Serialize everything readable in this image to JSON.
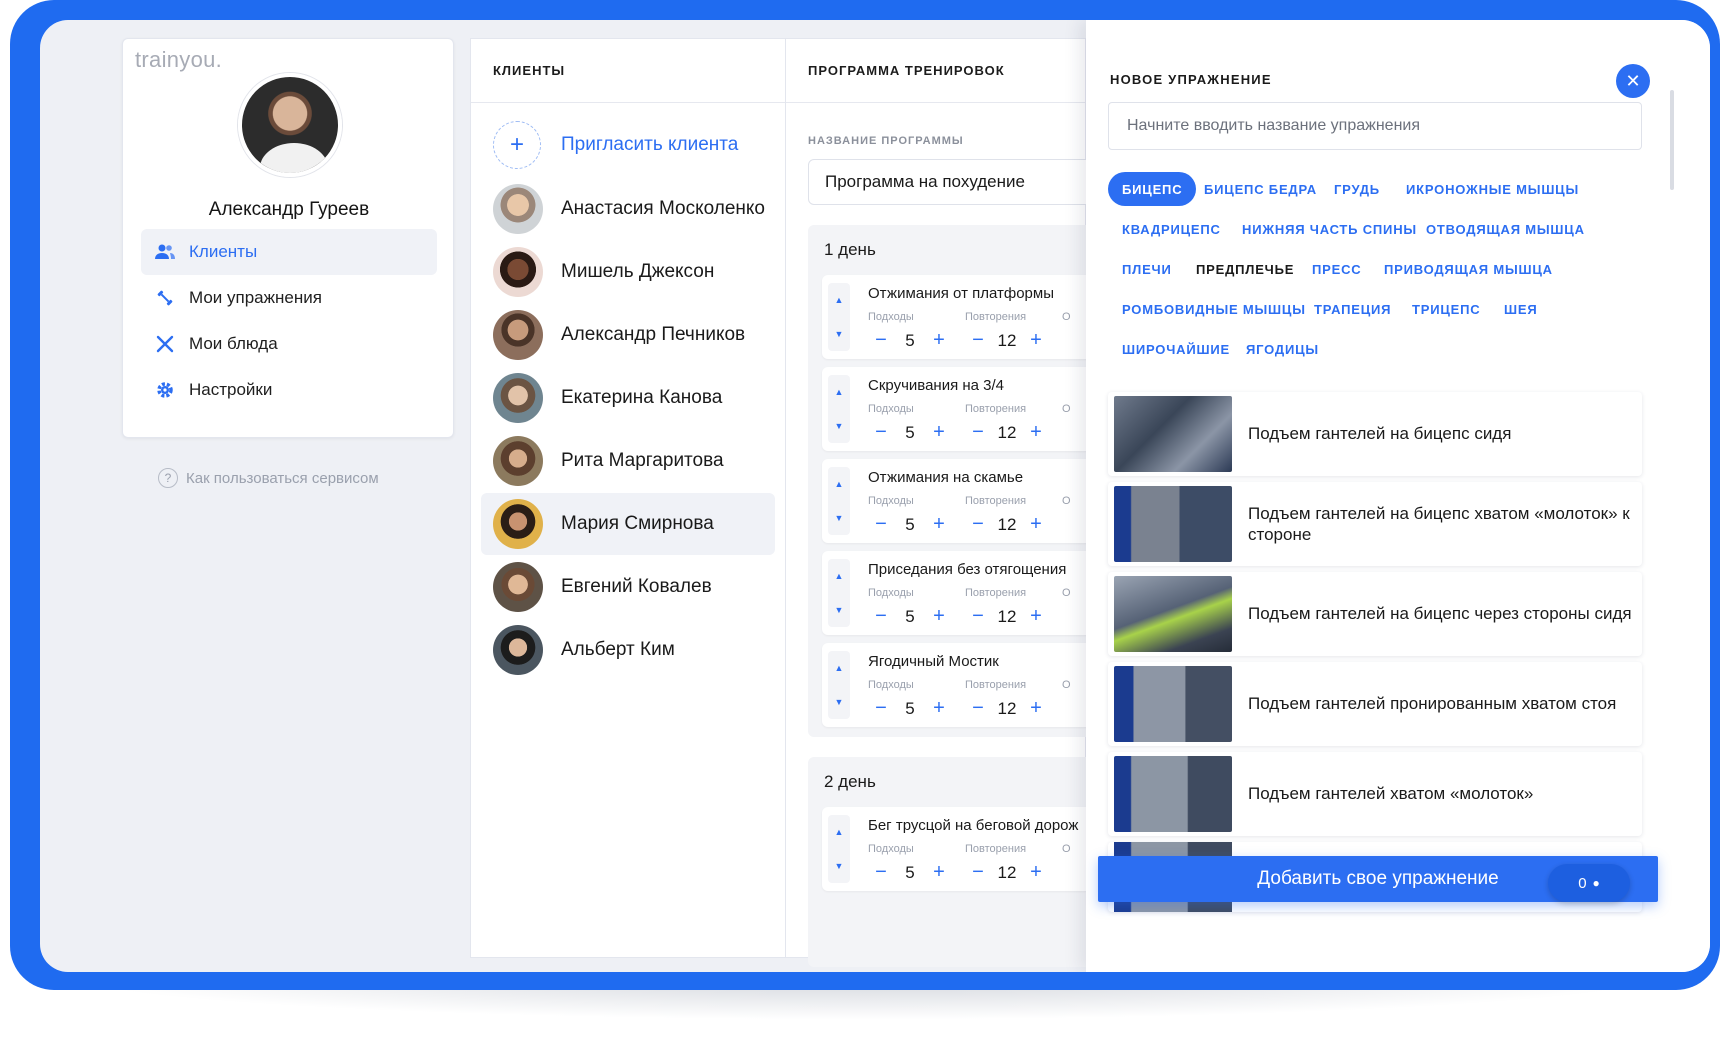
{
  "app": {
    "logo": "trainyou."
  },
  "profile": {
    "name": "Александр Гуреев"
  },
  "nav": {
    "items": [
      {
        "label": "Клиенты",
        "icon": "users-icon",
        "active": true
      },
      {
        "label": "Мои упражнения",
        "icon": "dumbbell-icon",
        "active": false
      },
      {
        "label": "Мои блюда",
        "icon": "cutlery-icon",
        "active": false
      },
      {
        "label": "Настройки",
        "icon": "gear-icon",
        "active": false
      }
    ],
    "help": "Как пользоваться сервисом"
  },
  "clients": {
    "header": "КЛИЕНТЫ",
    "invite": "Пригласить клиента",
    "list": [
      {
        "name": "Анастасия Москоленко"
      },
      {
        "name": "Мишель Джексон"
      },
      {
        "name": "Александр Печников"
      },
      {
        "name": "Екатерина Канова"
      },
      {
        "name": "Рита Маргаритова"
      },
      {
        "name": "Мария Смирнова",
        "selected": true
      },
      {
        "name": "Евгений Ковалев"
      },
      {
        "name": "Альберт Ким"
      }
    ]
  },
  "program": {
    "header": "ПРОГРАММА ТРЕНИРОВОК",
    "name_label": "НАЗВАНИЕ ПРОГРАММЫ",
    "name_value": "Программа на похудение",
    "sets_label": "Подходы",
    "reps_label": "Повторения",
    "third_label_partial": "О",
    "days": [
      {
        "title": "1 день",
        "exercises": [
          {
            "name": "Отжимания от платформы",
            "sets": "5",
            "reps": "12"
          },
          {
            "name": "Скручивания на 3/4",
            "sets": "5",
            "reps": "12"
          },
          {
            "name": "Отжимания на скамье",
            "sets": "5",
            "reps": "12"
          },
          {
            "name": "Приседания без отягощения",
            "sets": "5",
            "reps": "12"
          },
          {
            "name": "Ягодичный Мостик",
            "sets": "5",
            "reps": "12"
          }
        ]
      },
      {
        "title": "2 день",
        "exercises": [
          {
            "name": "Бег трусцой на беговой дорож",
            "sets": "5",
            "reps": "12"
          }
        ]
      }
    ]
  },
  "new_exercise": {
    "title": "НОВОЕ УПРАЖНЕНИЕ",
    "search_placeholder": "Начните вводить название упражнения",
    "tags": [
      "БИЦЕПС",
      "БИЦЕПС БЕДРА",
      "ГРУДЬ",
      "ИКРОНОЖНЫЕ МЫШЦЫ",
      "КВАДРИЦЕПС",
      "НИЖНЯЯ ЧАСТЬ СПИНЫ",
      "ОТВОДЯЩАЯ МЫШЦА",
      "ПЛЕЧИ",
      "ПРЕДПЛЕЧЬЕ",
      "ПРЕСС",
      "ПРИВОДЯЩАЯ МЫШЦА",
      "РОМБОВИДНЫЕ МЫШЦЫ",
      "ТРАПЕЦИЯ",
      "ТРИЦЕПС",
      "ШЕЯ",
      "ШИРОЧАЙШИЕ",
      "ЯГОДИЦЫ"
    ],
    "active_tag": "БИЦЕПС",
    "exercises": [
      "Подъем гантелей на бицепс сидя",
      "Подъем гантелей на бицепс хватом «молоток» к стороне",
      "Подъем гантелей на бицепс через стороны сидя",
      "Подъем гантелей пронированным хватом стоя",
      "Подъем гантелей хватом «молоток»"
    ],
    "add_button": "Добавить свое упражнение",
    "chat_count": "0"
  },
  "colors": {
    "accent": "#2c6ef2",
    "frame": "#1f6bf0",
    "background": "#eef0f5"
  }
}
